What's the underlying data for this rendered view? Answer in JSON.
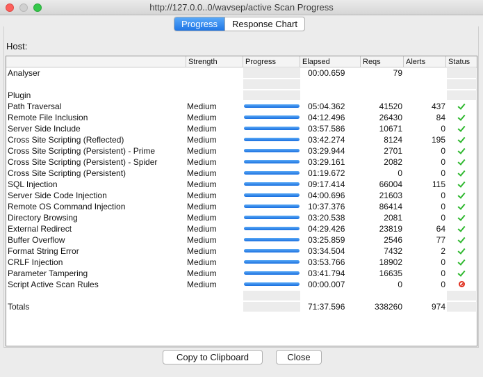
{
  "window": {
    "title": "http://127.0.0..0/wavsep/active Scan Progress"
  },
  "tabs": [
    {
      "label": "Progress",
      "active": true
    },
    {
      "label": "Response Chart",
      "active": false
    }
  ],
  "host_label": "Host:",
  "columns": [
    "",
    "Strength",
    "Progress",
    "Elapsed",
    "Reqs",
    "Alerts",
    "Status"
  ],
  "analyser": {
    "name": "Analyser",
    "elapsed": "00:00.659",
    "reqs": "79"
  },
  "plugin_header": "Plugin",
  "rows": [
    {
      "name": "Path Traversal",
      "strength": "Medium",
      "progress": 100,
      "elapsed": "05:04.362",
      "reqs": "41520",
      "alerts": "437",
      "status": "complete"
    },
    {
      "name": "Remote File Inclusion",
      "strength": "Medium",
      "progress": 100,
      "elapsed": "04:12.496",
      "reqs": "26430",
      "alerts": "84",
      "status": "complete"
    },
    {
      "name": "Server Side Include",
      "strength": "Medium",
      "progress": 100,
      "elapsed": "03:57.586",
      "reqs": "10671",
      "alerts": "0",
      "status": "complete"
    },
    {
      "name": "Cross Site Scripting (Reflected)",
      "strength": "Medium",
      "progress": 100,
      "elapsed": "03:42.274",
      "reqs": "8124",
      "alerts": "195",
      "status": "complete"
    },
    {
      "name": "Cross Site Scripting (Persistent) - Prime",
      "strength": "Medium",
      "progress": 100,
      "elapsed": "03:29.944",
      "reqs": "2701",
      "alerts": "0",
      "status": "complete"
    },
    {
      "name": "Cross Site Scripting (Persistent) - Spider",
      "strength": "Medium",
      "progress": 100,
      "elapsed": "03:29.161",
      "reqs": "2082",
      "alerts": "0",
      "status": "complete"
    },
    {
      "name": "Cross Site Scripting (Persistent)",
      "strength": "Medium",
      "progress": 100,
      "elapsed": "01:19.672",
      "reqs": "0",
      "alerts": "0",
      "status": "complete"
    },
    {
      "name": "SQL Injection",
      "strength": "Medium",
      "progress": 100,
      "elapsed": "09:17.414",
      "reqs": "66004",
      "alerts": "115",
      "status": "complete"
    },
    {
      "name": "Server Side Code Injection",
      "strength": "Medium",
      "progress": 100,
      "elapsed": "04:00.696",
      "reqs": "21603",
      "alerts": "0",
      "status": "complete"
    },
    {
      "name": "Remote OS Command Injection",
      "strength": "Medium",
      "progress": 100,
      "elapsed": "10:37.376",
      "reqs": "86414",
      "alerts": "0",
      "status": "complete"
    },
    {
      "name": "Directory Browsing",
      "strength": "Medium",
      "progress": 100,
      "elapsed": "03:20.538",
      "reqs": "2081",
      "alerts": "0",
      "status": "complete"
    },
    {
      "name": "External Redirect",
      "strength": "Medium",
      "progress": 100,
      "elapsed": "04:29.426",
      "reqs": "23819",
      "alerts": "64",
      "status": "complete"
    },
    {
      "name": "Buffer Overflow",
      "strength": "Medium",
      "progress": 100,
      "elapsed": "03:25.859",
      "reqs": "2546",
      "alerts": "77",
      "status": "complete"
    },
    {
      "name": "Format String Error",
      "strength": "Medium",
      "progress": 100,
      "elapsed": "03:34.504",
      "reqs": "7432",
      "alerts": "2",
      "status": "complete"
    },
    {
      "name": "CRLF Injection",
      "strength": "Medium",
      "progress": 100,
      "elapsed": "03:53.766",
      "reqs": "18902",
      "alerts": "0",
      "status": "complete"
    },
    {
      "name": "Parameter Tampering",
      "strength": "Medium",
      "progress": 100,
      "elapsed": "03:41.794",
      "reqs": "16635",
      "alerts": "0",
      "status": "complete"
    },
    {
      "name": "Script Active Scan Rules",
      "strength": "Medium",
      "progress": 100,
      "elapsed": "00:00.007",
      "reqs": "0",
      "alerts": "0",
      "status": "skipped"
    }
  ],
  "totals": {
    "name": "Totals",
    "elapsed": "71:37.596",
    "reqs": "338260",
    "alerts": "974"
  },
  "buttons": {
    "copy": "Copy to Clipboard",
    "close": "Close"
  },
  "icons": {
    "complete": "check-icon",
    "skipped": "stop-icon"
  },
  "colors": {
    "accent": "#1f76e6",
    "check": "#2eb82e",
    "stop": "#e03020"
  }
}
